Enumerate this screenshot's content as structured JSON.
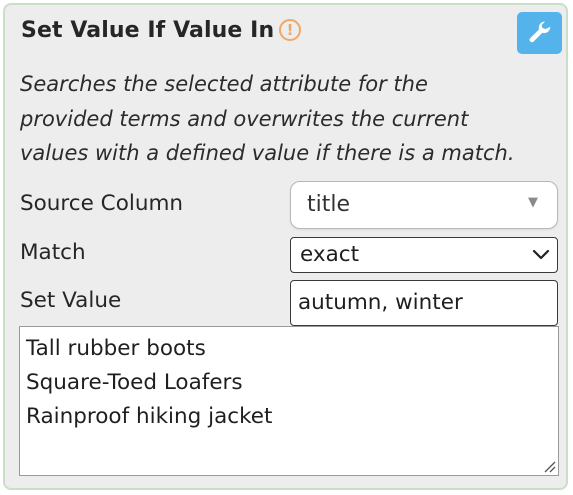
{
  "panel": {
    "title": "Set Value If Value In",
    "warning_icon_glyph": "!",
    "settings_icon": "wrench-icon",
    "description_lines": [
      "Searches the selected attribute for the",
      "provided terms and overwrites the current",
      "values with a defined value if there is a match."
    ]
  },
  "fields": {
    "source_column": {
      "label": "Source Column",
      "value": "title",
      "caret": "▼"
    },
    "match": {
      "label": "Match",
      "value": "exact"
    },
    "set_value": {
      "label": "Set Value",
      "value": "autumn, winter"
    }
  },
  "terms": {
    "lines": [
      "Tall rubber boots",
      "Square-Toed Loafers",
      "Rainproof hiking jacket"
    ]
  },
  "colors": {
    "panel_border": "#c9dfc7",
    "panel_bg": "#ededed",
    "accent_button": "#53b3ea",
    "warning": "#f0a868"
  }
}
